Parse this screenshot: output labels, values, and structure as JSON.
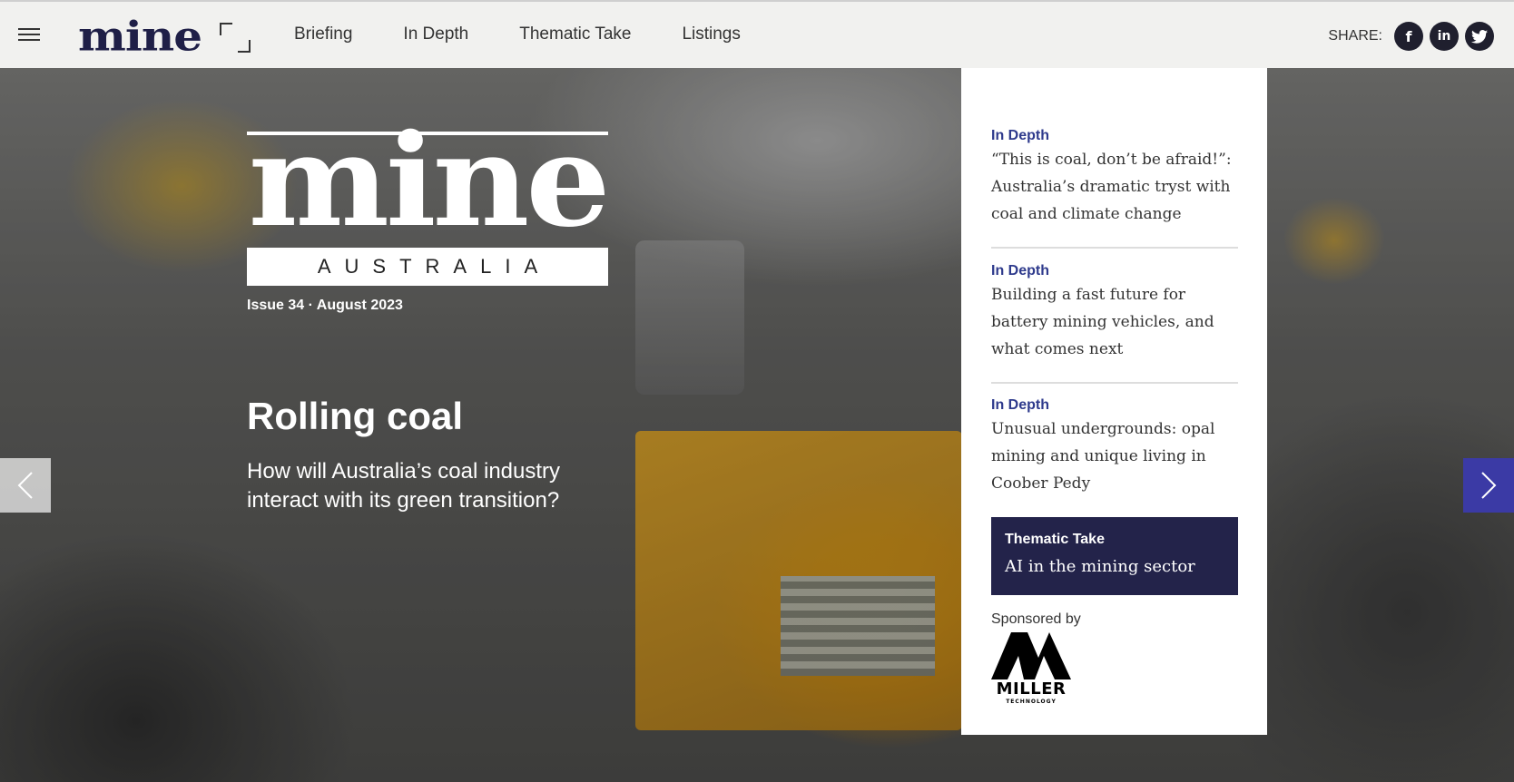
{
  "header": {
    "logo_text": "mine",
    "nav": [
      "Briefing",
      "In Depth",
      "Thematic Take",
      "Listings"
    ],
    "share_label": "SHARE:",
    "social": [
      {
        "icon": "facebook-icon",
        "glyph": "f"
      },
      {
        "icon": "linkedin-icon",
        "glyph": "in"
      },
      {
        "icon": "twitter-icon",
        "glyph": "🐦"
      }
    ]
  },
  "hero": {
    "logo_word": "mine",
    "logo_band": "AUSTRALIA",
    "issue": "Issue 34 · August 2023",
    "title": "Rolling coal",
    "subtitle": "How will Australia’s coal industry interact with its green transition?"
  },
  "panel": {
    "items": [
      {
        "category": "In Depth",
        "headline": "“This is coal, don’t be afraid!”: Australia’s dramatic tryst with coal and climate change"
      },
      {
        "category": "In Depth",
        "headline": "Building a fast future for battery mining vehicles, and what comes next"
      },
      {
        "category": "In Depth",
        "headline": "Unusual undergrounds: opal mining and unique living in Coober Pedy"
      }
    ],
    "thematic": {
      "category": "Thematic Take",
      "headline": "AI in the mining sector"
    },
    "sponsor_label": "Sponsored by",
    "sponsor_name": "MILLER",
    "sponsor_sub": "TECHNOLOGY"
  },
  "colors": {
    "accent": "#3b3aa5",
    "brand_navy": "#23234a",
    "category": "#2e3a8c"
  }
}
